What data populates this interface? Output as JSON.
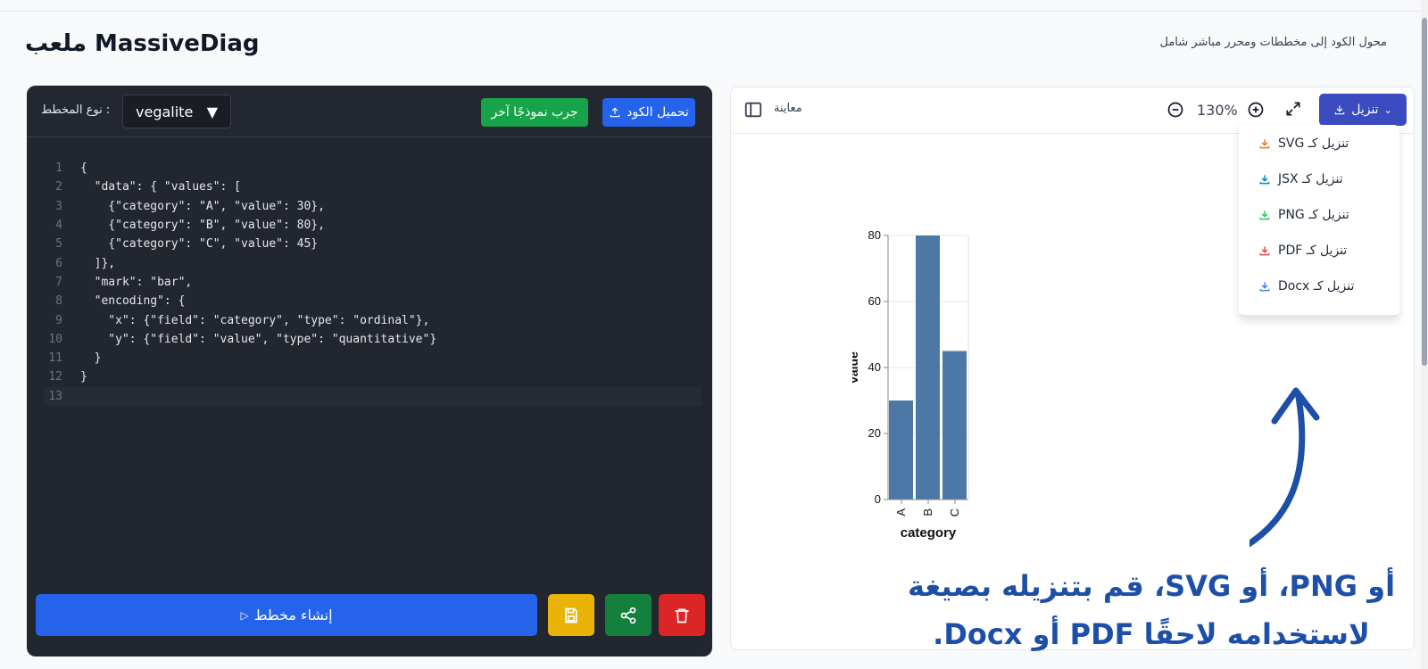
{
  "app": {
    "title": "MassiveDiag ملعب",
    "subtitle": "محول الكود إلى مخططات ومحرر مباشر شامل"
  },
  "editor": {
    "upload_label": "تحميل الكود",
    "sample_label": "جرب نموذجًا آخر",
    "type_label": ": نوع المخطط",
    "type_value": "vegalite",
    "lines": [
      "{",
      "  \"data\": { \"values\": [",
      "    {\"category\": \"A\", \"value\": 30},",
      "    {\"category\": \"B\", \"value\": 80},",
      "    {\"category\": \"C\", \"value\": 45}",
      "  ]},",
      "  \"mark\": \"bar\",",
      "  \"encoding\": {",
      "    \"x\": {\"field\": \"category\", \"type\": \"ordinal\"},",
      "    \"y\": {\"field\": \"value\", \"type\": \"quantitative\"}",
      "  }",
      "}",
      ""
    ],
    "create_label": "إنشاء مخطط",
    "icons": {
      "save": "save-icon",
      "share": "share-icon",
      "delete": "trash-icon"
    }
  },
  "preview": {
    "label": "معاينة",
    "zoom": "130%",
    "download_label": "تنزيل",
    "menu": [
      {
        "label": "تنزيل كـ SVG",
        "color": "#f97316"
      },
      {
        "label": "تنزيل كـ JSX",
        "color": "#0284c7"
      },
      {
        "label": "تنزيل كـ PNG",
        "color": "#22c55e"
      },
      {
        "label": "تنزيل كـ PDF",
        "color": "#ef4444"
      },
      {
        "label": "تنزيل كـ Docx",
        "color": "#3b82f6"
      }
    ]
  },
  "annotation": {
    "line1": "أو PNG، أو SVG، قم بتنزيله بصيغة",
    "line2": "لاستخدامه لاحقًا PDF أو Docx.",
    "color": "#1e4fa8"
  },
  "chart_data": {
    "type": "bar",
    "categories": [
      "A",
      "B",
      "C"
    ],
    "values": [
      30,
      80,
      45
    ],
    "xlabel": "category",
    "ylabel": "value",
    "ylim": [
      0,
      80
    ],
    "yticks": [
      0,
      20,
      40,
      60,
      80
    ],
    "color": "#4c78a8",
    "grid": true
  }
}
